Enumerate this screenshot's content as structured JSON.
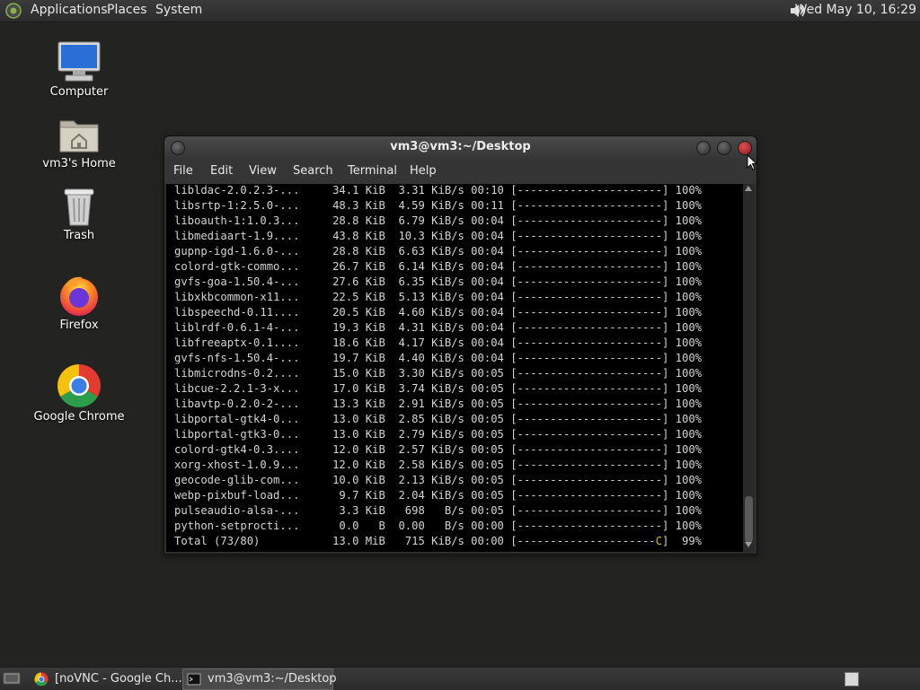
{
  "top_panel": {
    "menus": [
      "Applications",
      "Places",
      "System"
    ],
    "clock": "Wed May 10, 16:29",
    "volume_icon": "speaker-icon"
  },
  "desktop_icons": [
    {
      "label": "Computer",
      "icon": "computer-icon"
    },
    {
      "label": "vm3's Home",
      "icon": "home-folder-icon"
    },
    {
      "label": "Trash",
      "icon": "trash-icon"
    },
    {
      "label": "Firefox",
      "icon": "firefox-icon"
    },
    {
      "label": "Google Chrome",
      "icon": "chrome-icon"
    }
  ],
  "terminal": {
    "title": "vm3@vm3:~/Desktop",
    "menu": [
      "File",
      "Edit",
      "View",
      "Search",
      "Terminal",
      "Help"
    ],
    "lines": [
      "libldac-2.0.2.3-...     34.1 KiB  3.31 KiB/s 00:10 [----------------------] 100%",
      "libsrtp-1:2.5.0-...     48.3 KiB  4.59 KiB/s 00:11 [----------------------] 100%",
      "liboauth-1:1.0.3...     28.8 KiB  6.79 KiB/s 00:04 [----------------------] 100%",
      "libmediaart-1.9....     43.8 KiB  10.3 KiB/s 00:04 [----------------------] 100%",
      "gupnp-igd-1.6.0-...     28.8 KiB  6.63 KiB/s 00:04 [----------------------] 100%",
      "colord-gtk-commo...     26.7 KiB  6.14 KiB/s 00:04 [----------------------] 100%",
      "gvfs-goa-1.50.4-...     27.6 KiB  6.35 KiB/s 00:04 [----------------------] 100%",
      "libxkbcommon-x11...     22.5 KiB  5.13 KiB/s 00:04 [----------------------] 100%",
      "libspeechd-0.11....     20.5 KiB  4.60 KiB/s 00:04 [----------------------] 100%",
      "liblrdf-0.6.1-4-...     19.3 KiB  4.31 KiB/s 00:04 [----------------------] 100%",
      "libfreeaptx-0.1....     18.6 KiB  4.17 KiB/s 00:04 [----------------------] 100%",
      "gvfs-nfs-1.50.4-...     19.7 KiB  4.40 KiB/s 00:04 [----------------------] 100%",
      "libmicrodns-0.2....     15.0 KiB  3.30 KiB/s 00:05 [----------------------] 100%",
      "libcue-2.2.1-3-x...     17.0 KiB  3.74 KiB/s 00:05 [----------------------] 100%",
      "libavtp-0.2.0-2-...     13.3 KiB  2.91 KiB/s 00:05 [----------------------] 100%",
      "libportal-gtk4-0...     13.0 KiB  2.85 KiB/s 00:05 [----------------------] 100%",
      "libportal-gtk3-0...     13.0 KiB  2.79 KiB/s 00:05 [----------------------] 100%",
      "colord-gtk4-0.3....     12.0 KiB  2.57 KiB/s 00:05 [----------------------] 100%",
      "xorg-xhost-1.0.9...     12.0 KiB  2.58 KiB/s 00:05 [----------------------] 100%",
      "geocode-glib-com...     10.0 KiB  2.13 KiB/s 00:05 [----------------------] 100%",
      "webp-pixbuf-load...      9.7 KiB  2.04 KiB/s 00:05 [----------------------] 100%",
      "pulseaudio-alsa-...      3.3 KiB   698   B/s 00:05 [----------------------] 100%",
      "python-setprocti...      0.0   B  0.00   B/s 00:00 [----------------------] 100%"
    ],
    "total_prefix": "Total (73/80)           13.0 MiB   715 KiB/s 00:00 [---------------------",
    "total_marker": "C",
    "total_suffix": "]  99%",
    "marker_color": "#e8c000"
  },
  "taskbar": {
    "tasks": [
      {
        "label": "[noVNC - Google Ch...",
        "icon": "chrome-icon",
        "active": false
      },
      {
        "label": "vm3@vm3:~/Desktop",
        "icon": "terminal-icon",
        "active": true
      }
    ]
  }
}
